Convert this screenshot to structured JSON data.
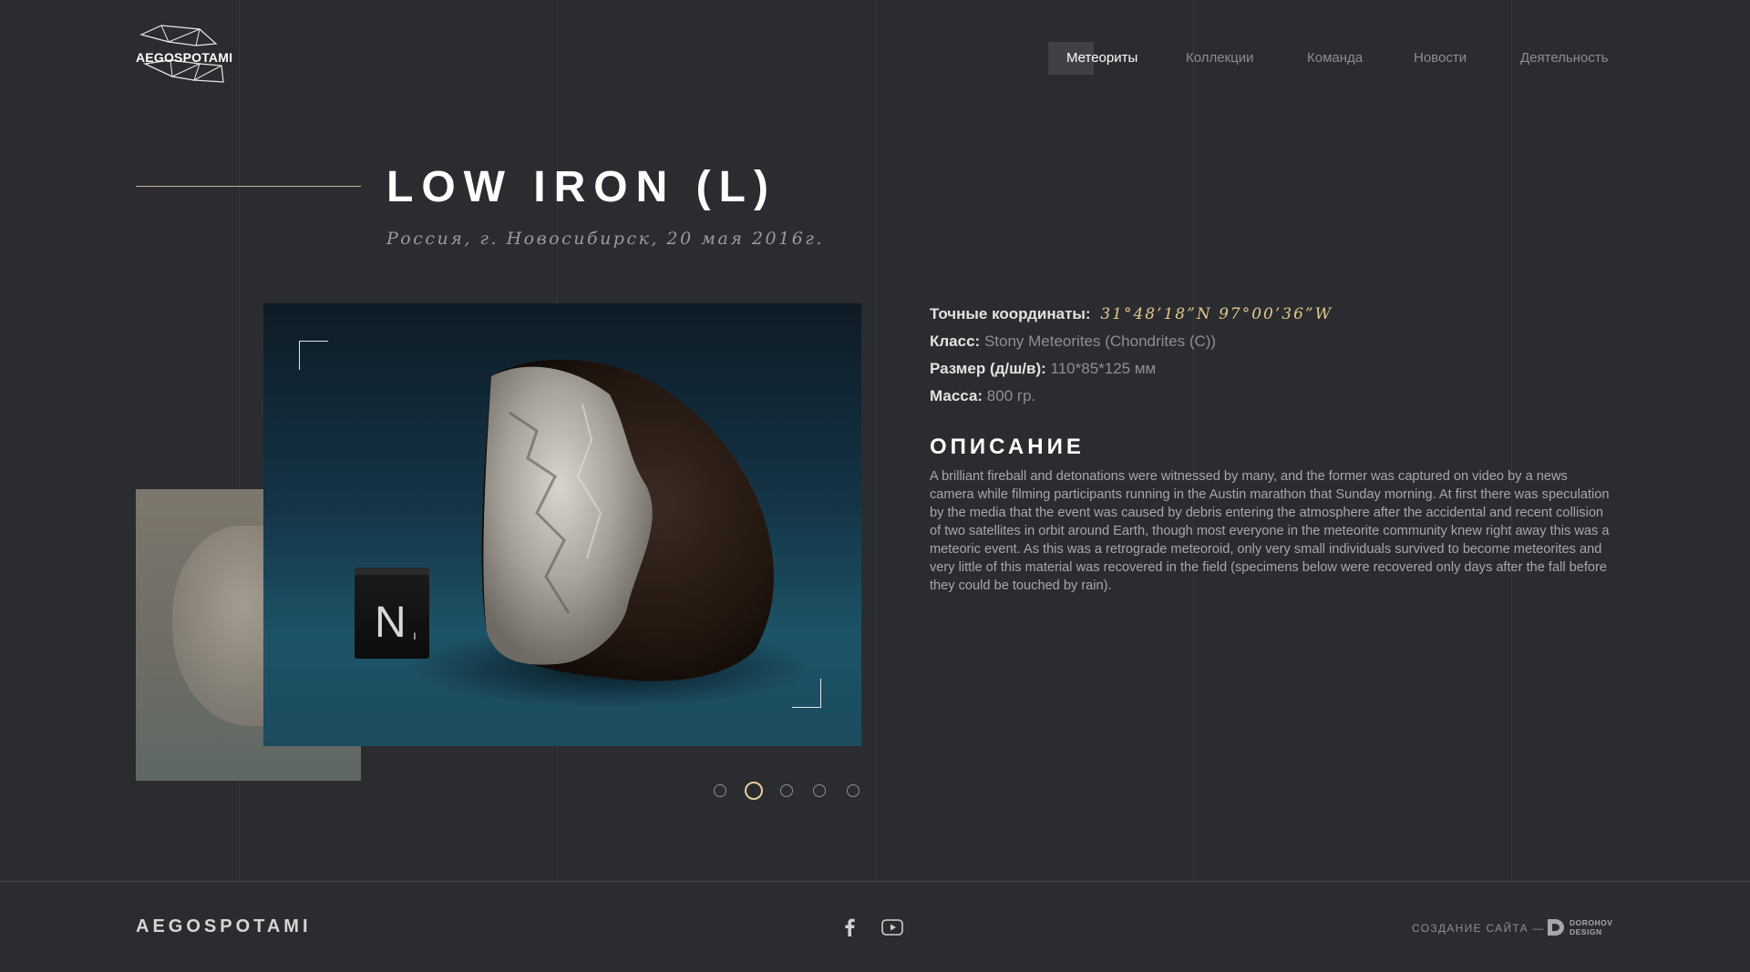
{
  "header": {
    "logo_text": "AEGOSPOTAMI",
    "nav": [
      {
        "label": "Метеориты",
        "active": true
      },
      {
        "label": "Коллекции",
        "active": false
      },
      {
        "label": "Команда",
        "active": false
      },
      {
        "label": "Новости",
        "active": false
      },
      {
        "label": "Деятельность",
        "active": false
      }
    ]
  },
  "meteorite": {
    "title": "LOW IRON (L)",
    "subtitle": "Россия, г. Новосибирск, 20 мая 2016г.",
    "cube_label": "N",
    "cube_sub": "ı",
    "carousel": {
      "count": 5,
      "active_index": 1
    },
    "details": {
      "coords_label": "Точные координаты:",
      "coords_value": "31°48’18”N 97°00’36”W",
      "class_label": "Класс:",
      "class_value": "Stony Meteorites (Chondrites (C))",
      "size_label": "Размер (д/ш/в):",
      "size_value": "110*85*125 мм",
      "mass_label": "Масса:",
      "mass_value": "800 гр."
    },
    "description_title": "ОПИСАНИЕ",
    "description": "A brilliant fireball and detonations were witnessed by many, and the former was captured on video by a news camera while filming participants running in the Austin marathon that Sunday morning. At first there was speculation by the media that the event was caused by debris entering the atmosphere after the accidental and recent collision of two satellites in orbit around Earth, though most everyone in the meteorite community knew right away this was a meteoric event. As this was a retrograde meteoroid, only very small individuals survived to become meteorites and very little of this material was recovered in the field (specimens below were recovered only days after the fall before they could be touched by rain)."
  },
  "footer": {
    "brand": "AEGOSPOTAMI",
    "social": [
      "facebook-icon",
      "youtube-icon"
    ],
    "credit": "СОЗДАНИЕ САЙТА —",
    "credit_logo_line1": "DOROHOV",
    "credit_logo_line2": "DESIGN"
  },
  "colors": {
    "background": "#2b2c30",
    "accent_gold": "#e3c98e",
    "title_white": "#ffffff"
  }
}
